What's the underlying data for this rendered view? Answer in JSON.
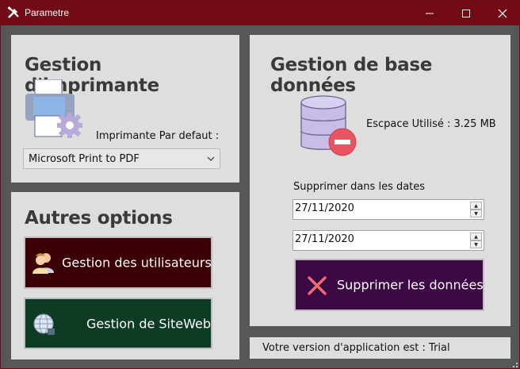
{
  "window": {
    "title": "Parametre",
    "controls": {
      "minimize": "—",
      "maximize": "☐",
      "close": "✕"
    }
  },
  "printer_panel": {
    "heading": "Gestion d'imprimante",
    "default_label": "Imprimante Par defaut :",
    "select_value": "Microsoft Print to PDF"
  },
  "options_panel": {
    "heading": "Autres options",
    "users_button": "Gestion des utilisateurs",
    "website_button": "Gestion de SiteWeb"
  },
  "db_panel": {
    "heading": "Gestion de base données",
    "space_used": "Escpace Utilisé : 3.25 MB",
    "delete_dates_label": "Supprimer dans les dates",
    "date_from": "27/11/2020",
    "date_to": "27/11/2020",
    "delete_button": "Supprimer les données"
  },
  "status_bar": {
    "version_text": "Votre version d'application est : Trial"
  },
  "colors": {
    "titlebar": "#710a14",
    "panel": "#dedede",
    "users_button_bg": "#3a0006",
    "website_button_bg": "#0e3b23",
    "delete_button_bg": "#3d0945"
  },
  "icons": [
    "tools-icon",
    "printer-gear-icon",
    "database-remove-icon",
    "users-icon",
    "globe-icon",
    "delete-x-icon"
  ]
}
